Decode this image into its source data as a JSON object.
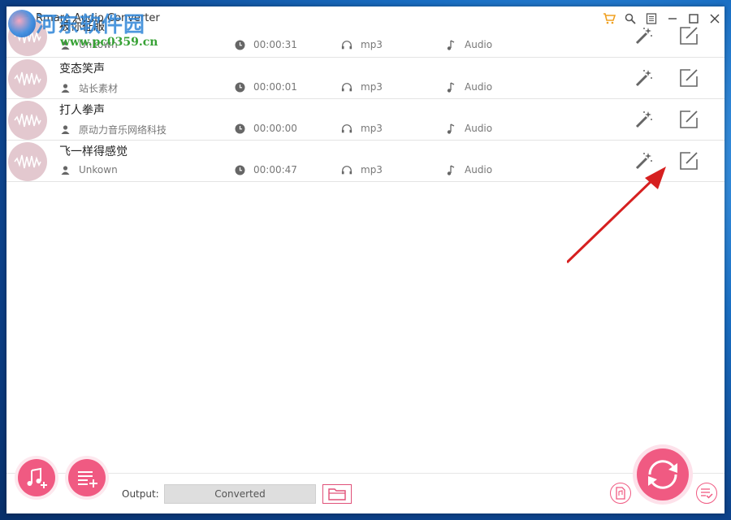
{
  "app": {
    "title": "Rmare Audio Converter"
  },
  "watermark": {
    "site_name": "河东软件园",
    "url": "www.pc0359.cn"
  },
  "titlebar_icons": [
    "cart-icon",
    "search-icon",
    "menu-icon",
    "minimize-icon",
    "maximize-icon",
    "close-icon"
  ],
  "tracks": [
    {
      "name": "被你征服",
      "artist": "Unkown",
      "duration": "00:00:31",
      "format": "mp3",
      "type": "Audio"
    },
    {
      "name": "变态笑声",
      "artist": "站长素材",
      "duration": "00:00:01",
      "format": "mp3",
      "type": "Audio"
    },
    {
      "name": "打人拳声",
      "artist": "原动力音乐网络科技",
      "duration": "00:00:00",
      "format": "mp3",
      "type": "Audio"
    },
    {
      "name": "飞一样得感觉",
      "artist": "Unkown",
      "duration": "00:00:47",
      "format": "mp3",
      "type": "Audio"
    }
  ],
  "bottom": {
    "output_label": "Output:",
    "output_value": "Converted"
  },
  "colors": {
    "accent": "#f05a82",
    "avatar_bg": "#e3c8cf",
    "annotation_arrow": "#d62020"
  }
}
